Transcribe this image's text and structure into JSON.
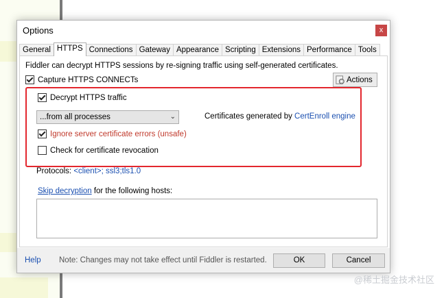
{
  "dialog": {
    "title": "Options",
    "close_label": "x"
  },
  "tabs": [
    {
      "label": "General"
    },
    {
      "label": "HTTPS"
    },
    {
      "label": "Connections"
    },
    {
      "label": "Gateway"
    },
    {
      "label": "Appearance"
    },
    {
      "label": "Scripting"
    },
    {
      "label": "Extensions"
    },
    {
      "label": "Performance"
    },
    {
      "label": "Tools"
    }
  ],
  "active_tab": "HTTPS",
  "https": {
    "intro": "Fiddler can decrypt HTTPS sessions by re-signing traffic using self-generated certificates.",
    "capture_label": "Capture HTTPS CONNECTs",
    "capture_checked": true,
    "actions_label": "Actions",
    "decrypt_label": "Decrypt HTTPS traffic",
    "decrypt_checked": true,
    "process_filter": "...from all processes",
    "certs_prefix": "Certificates generated by ",
    "certs_engine": "CertEnroll engine",
    "ignore_label": "Ignore server certificate errors (unsafe)",
    "ignore_checked": true,
    "revocation_label": "Check for certificate revocation",
    "revocation_checked": false,
    "protocols_label": "Protocols: ",
    "protocols_value": "<client>; ssl3;tls1.0",
    "skip_link": "Skip decryption",
    "skip_suffix": " for the following hosts:",
    "hosts_value": ""
  },
  "footer": {
    "help": "Help",
    "note": "Note: Changes may not take effect until Fiddler is restarted.",
    "ok": "OK",
    "cancel": "Cancel"
  },
  "watermark": "@稀土掘金技术社区",
  "colors": {
    "close_button": "#c74646",
    "highlight_border": "#e3262d",
    "link": "#1a4fb0"
  }
}
